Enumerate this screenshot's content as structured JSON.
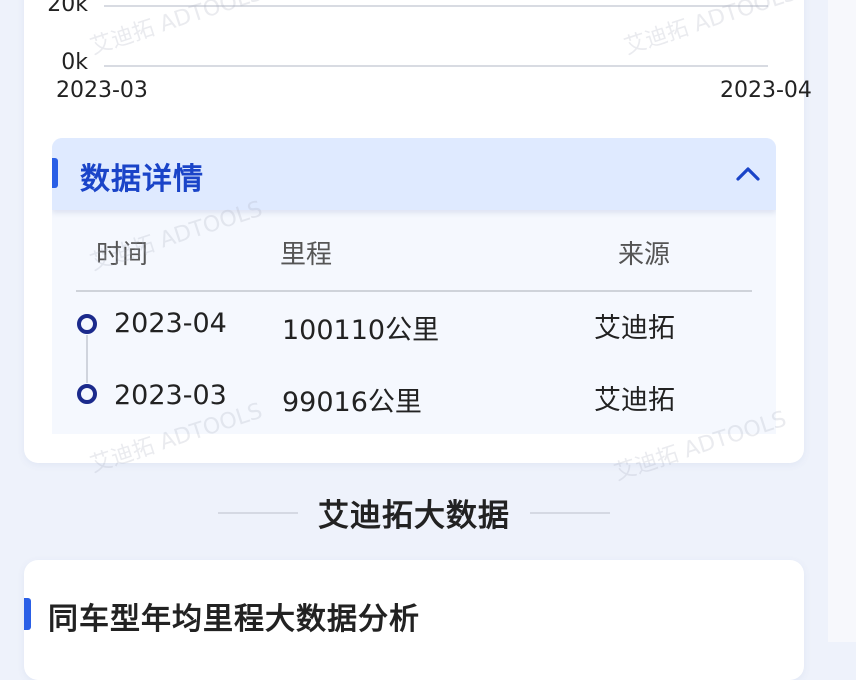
{
  "chart_data": {
    "type": "line",
    "y_ticks": [
      "20k",
      "0k"
    ],
    "x_ticks": [
      "2023-03",
      "2023-04"
    ],
    "grid": true,
    "colors": {
      "grid": "#d8dbe2"
    }
  },
  "details": {
    "title": "数据详情",
    "toggle_icon": "chevron-up-icon",
    "columns": {
      "time": "时间",
      "mileage": "里程",
      "source": "来源"
    },
    "rows": [
      {
        "time": "2023-04",
        "mileage": "100110公里",
        "source": "艾迪拓"
      },
      {
        "time": "2023-03",
        "mileage": "99016公里",
        "source": "艾迪拓"
      }
    ]
  },
  "big_data": {
    "title": "艾迪拓大数据"
  },
  "analysis": {
    "title": "同车型年均里程大数据分析"
  },
  "watermark": {
    "text": "艾迪拓 ADTOOLS"
  },
  "colors": {
    "accent": "#2a5fe6",
    "title_blue": "#1a44c8",
    "header_bg": "#dfeaff",
    "dot": "#1b2a8c"
  }
}
